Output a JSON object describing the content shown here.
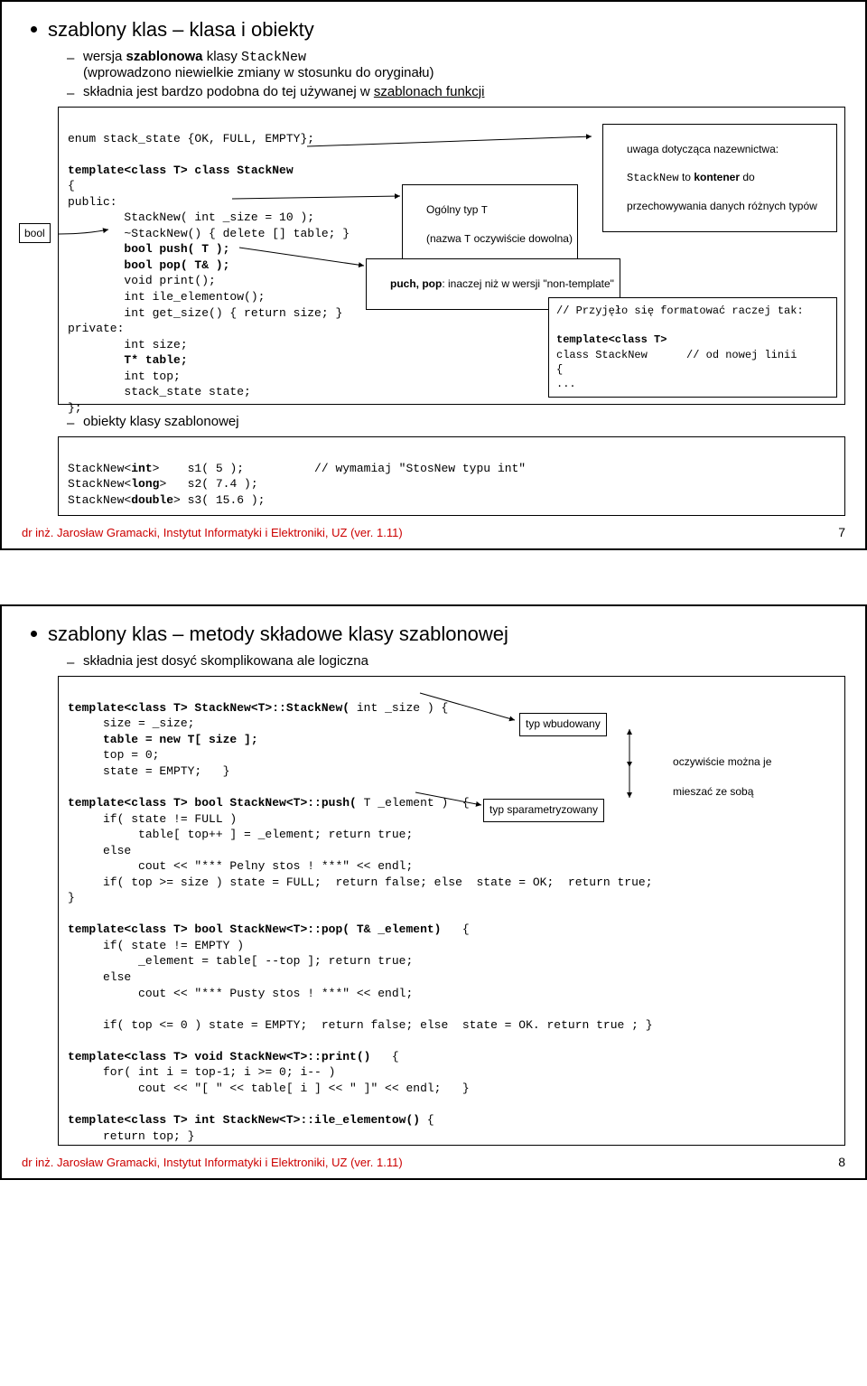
{
  "slide1": {
    "title": "szablony klas – klasa i obiekty",
    "sub1_pre": "wersja ",
    "sub1_bold": "szablonowa",
    "sub1_mid": " klasy ",
    "sub1_mono": "StackNew",
    "sub1_line2": "(wprowadzono niewielkie zmiany w stosunku do oryginału)",
    "sub2_pre": "składnia jest bardzo podobna do tej używanej w ",
    "sub2_under": "szablonach funkcji",
    "code1_l1": "enum stack_state {OK, FULL, EMPTY};",
    "code1_l2": "",
    "code1_l3a": "template<class T>",
    "code1_l3b": " class StackNew",
    "code1_l4": "{",
    "code1_l5": "public:",
    "code1_l6": "        StackNew( int _size = 10 );",
    "code1_l7": "        ~StackNew() { delete [] table; }",
    "code1_l8": "        bool push( T );",
    "code1_l9": "        bool pop( T& );",
    "code1_l10": "        void print();",
    "code1_l11": "        int ile_elementow();",
    "code1_l12": "        int get_size() { return size; }",
    "code1_l13": "private:",
    "code1_l14": "        int size;",
    "code1_l15": "        T* table;",
    "code1_l16": "        int top;",
    "code1_l17": "        stack_state state;",
    "code1_l18": "};",
    "side_bool": "bool",
    "noteA_l1": "uwaga dotycząca nazewnictwa:",
    "noteA_l2a": "StackNew",
    "noteA_l2b": " to ",
    "noteA_l2c": "kontener",
    "noteA_l2d": " do",
    "noteA_l3": "przechowywania danych różnych typów",
    "noteB_l1a": "Ogólny typ ",
    "noteB_l1b": "T",
    "noteB_l2a": "(nazwa ",
    "noteB_l2b": "T",
    "noteB_l2c": " oczywiście dowolna)",
    "noteC_a": "puch, pop",
    "noteC_b": ": inaczej niż w wersji \"non-template\"",
    "noteD_l1": "// Przyjęło się formatować raczej tak:",
    "noteD_l2": "",
    "noteD_l3": "template<class T>",
    "noteD_l4": "class StackNew      // od nowej linii",
    "noteD_l5": "{",
    "noteD_l6": "...",
    "sub3": "obiekty klasy szablonowej",
    "code2_l1a": "StackNew<",
    "code2_l1b": "int",
    "code2_l1c": ">    s1( 5 );          // wymamiaj \"StosNew typu int\"",
    "code2_l2a": "StackNew<",
    "code2_l2b": "long",
    "code2_l2c": ">   s2( 7.4 );",
    "code2_l3a": "StackNew<",
    "code2_l3b": "double",
    "code2_l3c": "> s3( 15.6 );",
    "footer": "dr inż. Jarosław Gramacki, Instytut Informatyki i Elektroniki, UZ (ver. 1.11)",
    "page": "7"
  },
  "slide2": {
    "title": "szablony klas – metody składowe klasy szablonowej",
    "sub1": "składnia jest dosyć skomplikowana ale logiczna",
    "code_l1a": "template<class T> StackNew<T>::StackNew(",
    "code_l1b": " int _size ) {",
    "code_l2": "     size = _size;",
    "code_l3": "     table = new T[ size ];",
    "code_l4": "     top = 0;",
    "code_l5": "     state = EMPTY;   }",
    "code_l6": "",
    "code_l7a": "template<class T> bool StackNew<T>::push(",
    "code_l7b": " T _element )",
    "code_l7c": "  {",
    "code_l8": "     if( state != FULL )",
    "code_l9": "          table[ top++ ] = _element; return true;",
    "code_l10": "     else",
    "code_l11": "          cout << \"*** Pelny stos ! ***\" << endl;",
    "code_l12": "     if( top >= size ) state = FULL;  return false; else  state = OK;  return true;",
    "code_l13": "}",
    "code_l14": "",
    "code_l15a": "template<class T> bool StackNew<T>::pop( T& _element)",
    "code_l15b": "   {",
    "code_l16": "     if( state != EMPTY )",
    "code_l17": "          _element = table[ --top ]; return true;",
    "code_l18": "     else",
    "code_l19": "          cout << \"*** Pusty stos ! ***\" << endl;",
    "code_l20": "",
    "code_l21": "     if( top <= 0 ) state = EMPTY;  return false; else  state = OK. return true ; }",
    "code_l22": "",
    "code_l23a": "template<class T> void StackNew<T>::print()",
    "code_l23b": "   {",
    "code_l24": "     for( int i = top-1; i >= 0; i-- )",
    "code_l25": "          cout << \"[ \" << table[ i ] << \" ]\" << endl;   }",
    "code_l26": "",
    "code_l27a": "template<class T> int StackNew<T>::ile_elementow()",
    "code_l27b": " {",
    "code_l28": "     return top; }",
    "noteE": "typ wbudowany",
    "noteF_l1": "oczywiście można je",
    "noteF_l2": "mieszać ze sobą",
    "noteG": "typ sparametryzowany",
    "footer": "dr inż. Jarosław Gramacki, Instytut Informatyki i Elektroniki, UZ (ver. 1.11)",
    "page": "8"
  }
}
